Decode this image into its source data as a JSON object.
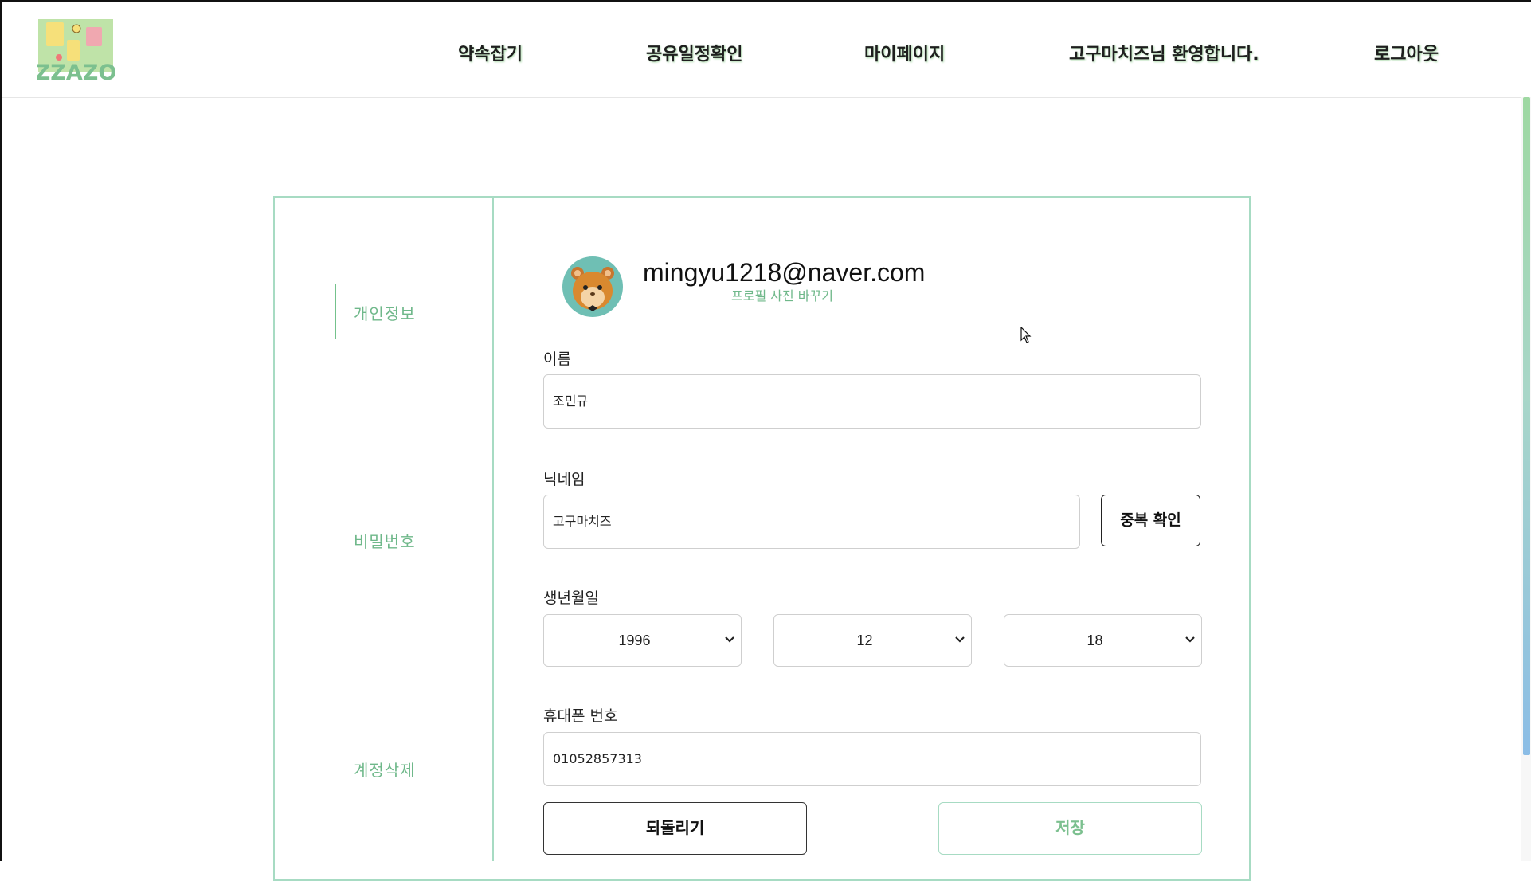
{
  "header": {
    "logo_text": "ZZAZO",
    "nav": [
      {
        "label": "약속잡기"
      },
      {
        "label": "공유일정확인"
      },
      {
        "label": "마이페이지"
      },
      {
        "label": "고구마치즈님 환영합니다."
      },
      {
        "label": "로그아웃"
      }
    ]
  },
  "sidebar": {
    "items": [
      {
        "label": "개인정보",
        "active": true
      },
      {
        "label": "비밀번호",
        "active": false
      },
      {
        "label": "계정삭제",
        "active": false
      }
    ]
  },
  "profile": {
    "email": "mingyu1218@naver.com",
    "change_photo_label": "프로필 사진 바꾸기"
  },
  "form": {
    "name": {
      "label": "이름",
      "value": "조민규"
    },
    "nickname": {
      "label": "닉네임",
      "value": "고구마치즈",
      "check_button": "중복 확인"
    },
    "birth": {
      "label": "생년월일",
      "year": "1996",
      "month": "12",
      "day": "18"
    },
    "phone": {
      "label": "휴대폰 번호",
      "value": "01052857313"
    },
    "revert_button": "되돌리기",
    "save_button": "저장"
  },
  "colors": {
    "accent_green": "#6fb88a",
    "panel_border": "#a7dbc3",
    "nav_shadow": "#a8d8a8"
  },
  "icons": {
    "avatar": "hamster-avatar-icon",
    "select_arrow": "chevron-down-icon",
    "cursor": "mouse-pointer-icon"
  }
}
